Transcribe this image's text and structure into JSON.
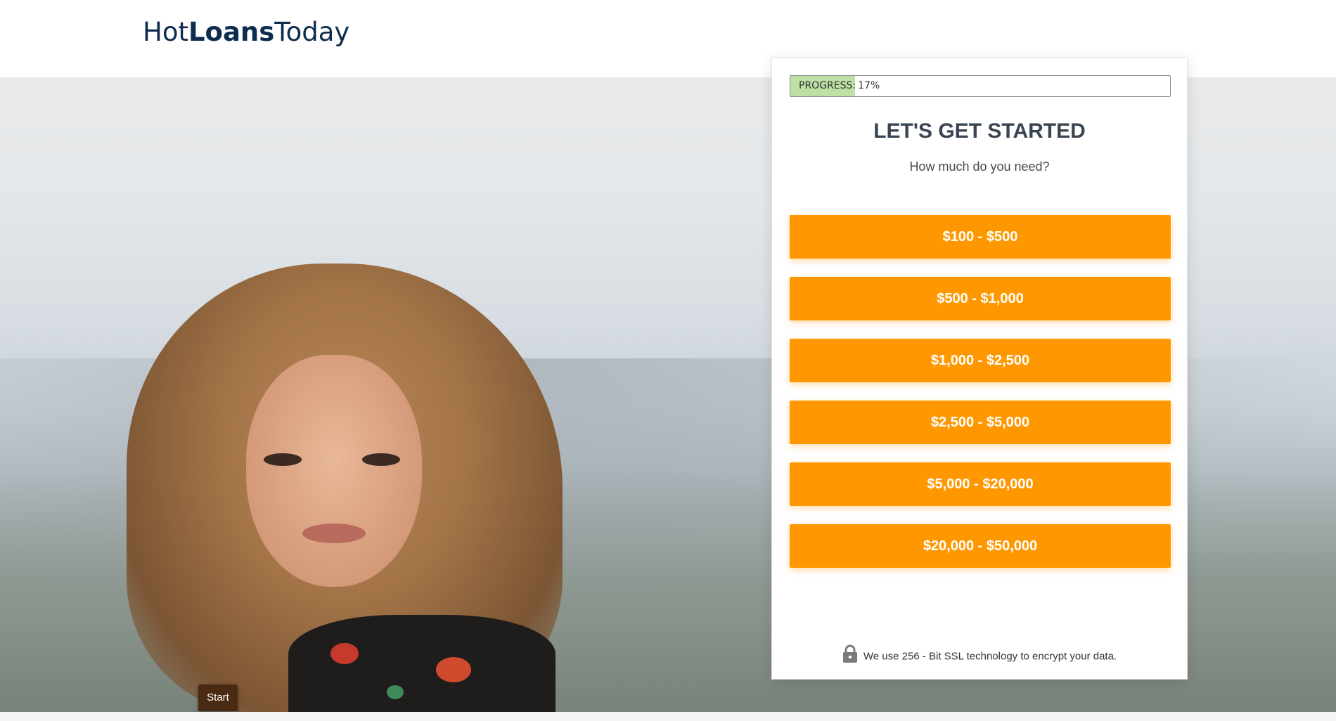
{
  "header": {
    "logo_part1": "Hot",
    "logo_part2": "Loans",
    "logo_part3": "Today"
  },
  "form": {
    "progress_label": "PROGRESS:",
    "progress_value": "17%",
    "progress_fraction": 0.17,
    "title": "LET'S GET STARTED",
    "subtitle": "How much do you need?",
    "amount_options": [
      "$100 - $500",
      "$500 - $1,000",
      "$1,000 - $2,500",
      "$2,500 - $5,000",
      "$5,000 - $20,000",
      "$20,000 - $50,000"
    ],
    "security_note": "We use 256 - Bit SSL technology to encrypt your data."
  },
  "footer_tab": {
    "label": "Start"
  },
  "colors": {
    "accent": "#ff9800",
    "logo": "#0d2c4e",
    "progress_fill": "#bde0a5",
    "title": "#394452"
  }
}
